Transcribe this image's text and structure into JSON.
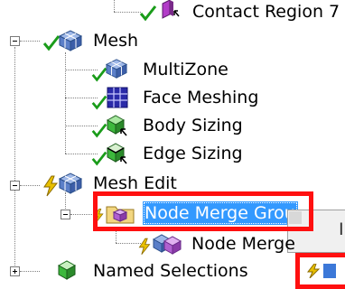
{
  "tree": {
    "contact_region_7": "Contact Region 7",
    "mesh": "Mesh",
    "multizone": "MultiZone",
    "face_meshing": "Face Meshing",
    "body_sizing": "Body Sizing",
    "edge_sizing": "Edge Sizing",
    "mesh_edit": "Mesh Edit",
    "node_merge_group": "Node Merge Grou",
    "node_merge": "Node Merge",
    "named_selections": "Named Selections"
  },
  "popup": {
    "fragment": "I"
  },
  "colors": {
    "selection": "#3399ff",
    "annotation": "#ff1010",
    "check": "#1a9c1a",
    "bolt": "#e8c000"
  }
}
